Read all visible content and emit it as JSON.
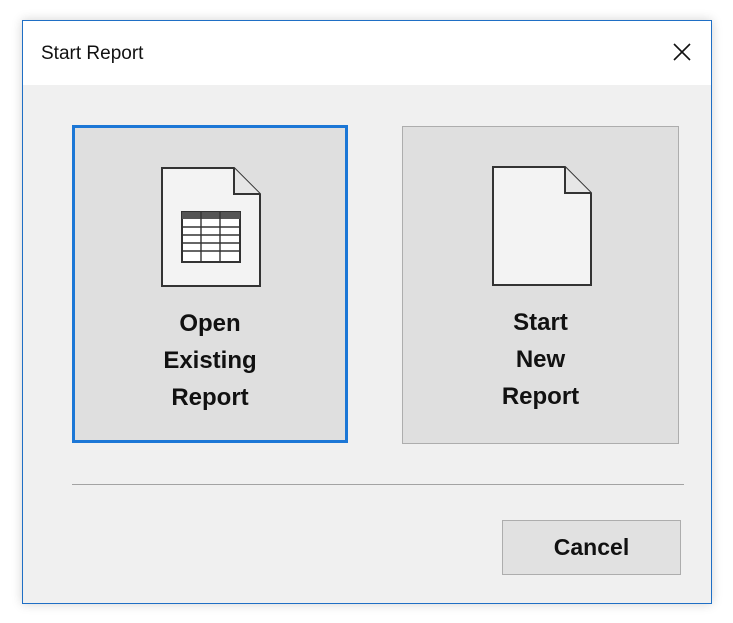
{
  "dialog": {
    "title": "Start Report",
    "close_icon": "close-icon"
  },
  "options": {
    "open_existing": {
      "icon": "spreadsheet-document-icon",
      "lines": [
        "Open",
        "Existing",
        "Report"
      ]
    },
    "start_new": {
      "icon": "blank-document-icon",
      "lines": [
        "Start",
        "New",
        "Report"
      ]
    }
  },
  "footer": {
    "cancel_label": "Cancel"
  },
  "colors": {
    "focus_border": "#1c77d6",
    "window_border": "#1f6fc5",
    "dialog_background": "#f0f0f0",
    "tile_background": "#dfdfdf"
  }
}
